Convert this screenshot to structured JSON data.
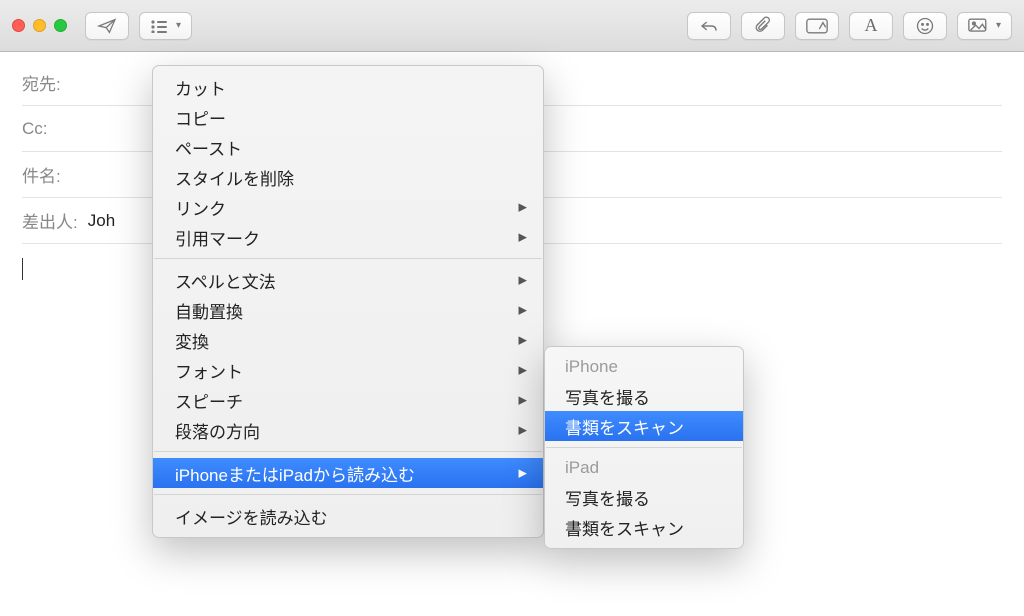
{
  "toolbar": {
    "icons": {
      "send": "send-icon",
      "list": "list-icon",
      "reply": "reply-icon",
      "attach": "attach-icon",
      "markup": "markup-icon",
      "font": "font-icon",
      "emoji": "emoji-icon",
      "photo": "photo-icon"
    }
  },
  "compose": {
    "to_label": "宛先:",
    "cc_label": "Cc:",
    "subject_label": "件名:",
    "from_label": "差出人:",
    "from_value": "Joh"
  },
  "context_menu": {
    "group1": [
      "カット",
      "コピー",
      "ペースト",
      "スタイルを削除"
    ],
    "group1_sub": [
      "リンク",
      "引用マーク"
    ],
    "group2_sub": [
      "スペルと文法",
      "自動置換",
      "変換",
      "フォント",
      "スピーチ",
      "段落の方向"
    ],
    "highlighted": "iPhoneまたはiPadから読み込む",
    "group3": [
      "イメージを読み込む"
    ]
  },
  "submenu": {
    "groups": [
      {
        "title": "iPhone",
        "items": [
          {
            "label": "写真を撮る",
            "highlight": false
          },
          {
            "label": "書類をスキャン",
            "highlight": true
          }
        ]
      },
      {
        "title": "iPad",
        "items": [
          {
            "label": "写真を撮る",
            "highlight": false
          },
          {
            "label": "書類をスキャン",
            "highlight": false
          }
        ]
      }
    ]
  }
}
